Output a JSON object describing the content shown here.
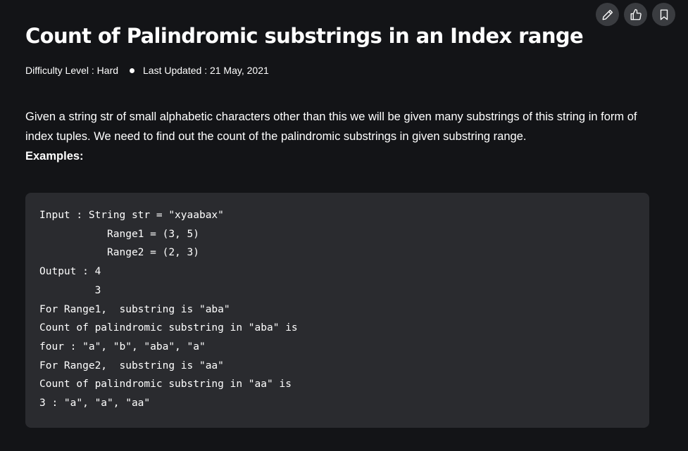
{
  "article": {
    "title": "Count of Palindromic substrings in an Index range",
    "difficulty": "Difficulty Level : Hard",
    "last_updated": "Last Updated : 21 May, 2021",
    "description": "Given a string str of small alphabetic characters other than this we will be given many substrings of this string in form of index tuples. We need to find out the count of the palindromic substrings in given substring range.",
    "examples_label": "Examples:",
    "code_example": "Input : String str = \"xyaabax\"\n           Range1 = (3, 5)\n           Range2 = (2, 3)\nOutput : 4\n         3\nFor Range1,  substring is \"aba\"\nCount of palindromic substring in \"aba\" is\nfour : \"a\", \"b\", \"aba\", \"a\"\nFor Range2,  substring is \"aa\"\nCount of palindromic substring in \"aa\" is\n3 : \"a\", \"a\", \"aa\""
  },
  "actions": {
    "icons": [
      "pencil-icon",
      "thumbs-up-icon",
      "bookmark-icon"
    ]
  },
  "colors": {
    "background": "#131417",
    "code_background": "#2a2b2f",
    "action_button": "#3a3c40",
    "text": "#ffffff"
  }
}
